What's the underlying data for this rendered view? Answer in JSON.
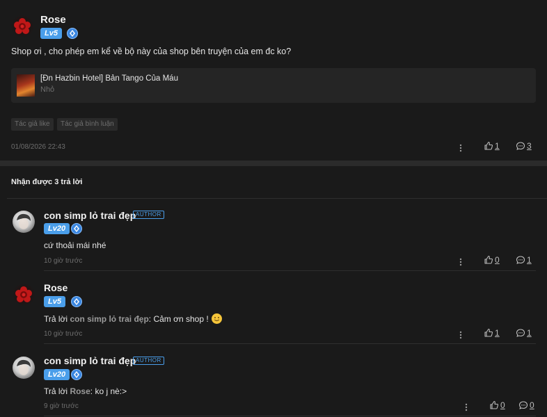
{
  "post": {
    "username": "Rose",
    "level": "Lv5",
    "message": "Shop ơi , cho phép em kể về bộ này của shop bên truyện của em đc ko?",
    "book": {
      "title": "[Đn Hazbin Hotel] Bản Tango Của Máu",
      "subtitle": "Nhỏ"
    },
    "tags": [
      "Tác giả like",
      "Tác giả bình luận"
    ],
    "timestamp": "01/08/2026 22:43",
    "likes": "1",
    "comments": "3"
  },
  "replies_header": "Nhận được 3 trả lời",
  "replies": [
    {
      "username": "con simp lỏ trai đẹp",
      "author_badge": "AUTHOR",
      "level": "Lv20",
      "text": "cứ thoải mái nhé",
      "time": "10 giờ trước",
      "likes": "0",
      "comments": "1"
    },
    {
      "username": "Rose",
      "level": "Lv5",
      "reply_prefix": "Trả lời",
      "reply_to": "con simp lỏ trai đẹp",
      "text": ": Cảm ơn shop !",
      "time": "10 giờ trước",
      "likes": "1",
      "comments": "1"
    },
    {
      "username": "con simp lỏ trai đẹp",
      "author_badge": "AUTHOR",
      "level": "Lv20",
      "reply_prefix": "Trả lời",
      "reply_to": "Rose",
      "text": ": ko j nè:>",
      "time": "9 giờ trước",
      "likes": "0",
      "comments": "0"
    }
  ],
  "icons": {
    "vip": "vip-diamond-icon",
    "more": "more-vertical-icon",
    "like": "thumbs-up-icon",
    "comment": "comment-bubble-icon",
    "emoji": "smile-emoji-icon"
  },
  "colors": {
    "background": "#1a1a1a",
    "accent": "#4a9eea",
    "card": "#252525"
  }
}
